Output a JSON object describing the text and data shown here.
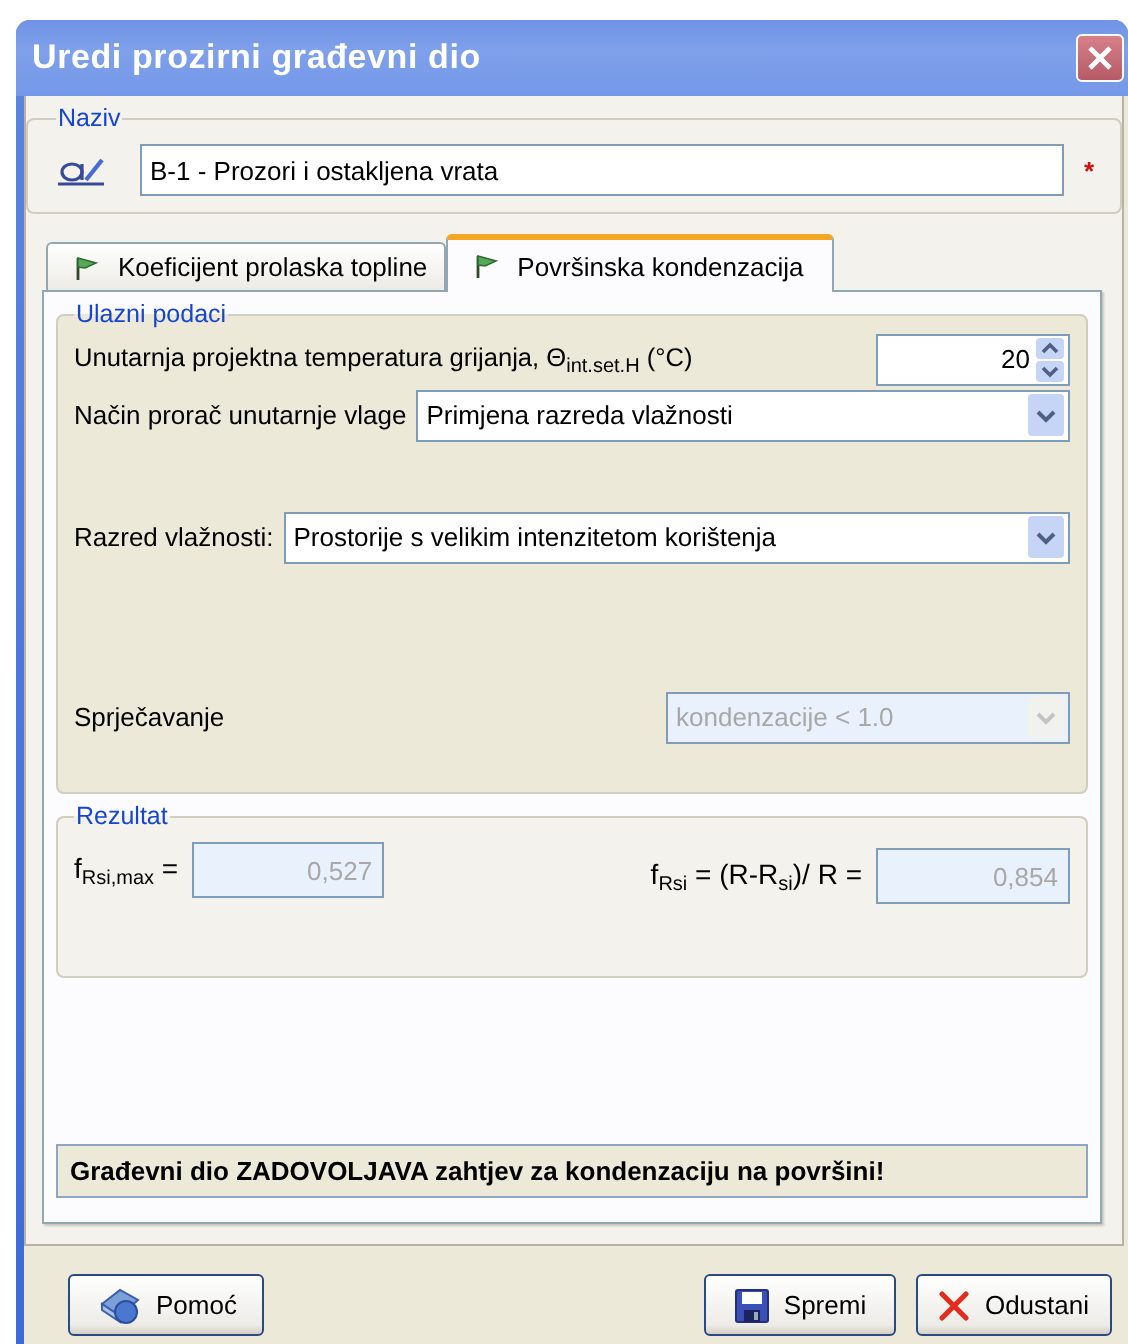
{
  "window": {
    "title": "Uredi prozirni građevni dio"
  },
  "name_group": {
    "legend": "Naziv",
    "value": "B-1 - Prozori i ostakljena vrata",
    "required_mark": "*"
  },
  "tabs": [
    {
      "label": "Koeficijent prolaska topline",
      "selected": false
    },
    {
      "label": "Površinska kondenzacija",
      "selected": true
    }
  ],
  "input_group": {
    "legend": "Ulazni podaci",
    "fields": [
      {
        "kind": "spin",
        "label": "Unutarnja projektna temperatura grijanja, Θ$_{int.set.H}$ (°C)",
        "value": "20",
        "disabled": false
      },
      {
        "kind": "combo",
        "label": "Način prorač unutarnje vlage",
        "value": "Primjena razreda vlažnosti",
        "disabled": false
      },
      {
        "kind": "combo",
        "label": "Razred vlažnosti:",
        "value": "Prostorije s velikim intenzitetom korištenja",
        "disabled": false
      },
      {
        "kind": "combo",
        "label": "Sprječavanje",
        "value": "kondenzacije < 1.0",
        "disabled": true
      }
    ]
  },
  "result_group": {
    "legend": "Rezultat",
    "fields": [
      {
        "label": "f$_{Rsi,max}$ =",
        "value": "0,527",
        "disabled": true
      },
      {
        "label": "f$_{Rsi}$ = (R-R$_{si}$)/ R =",
        "value": "0,854",
        "disabled": true
      }
    ]
  },
  "message": "Građevni dio ZADOVOLJAVA zahtjev za kondenzaciju na površini!",
  "buttons": [
    {
      "kind": "help",
      "label": "Pomoć"
    },
    {
      "kind": "save",
      "label": "Spremi"
    },
    {
      "kind": "cancel",
      "label": "Odustani"
    }
  ]
}
